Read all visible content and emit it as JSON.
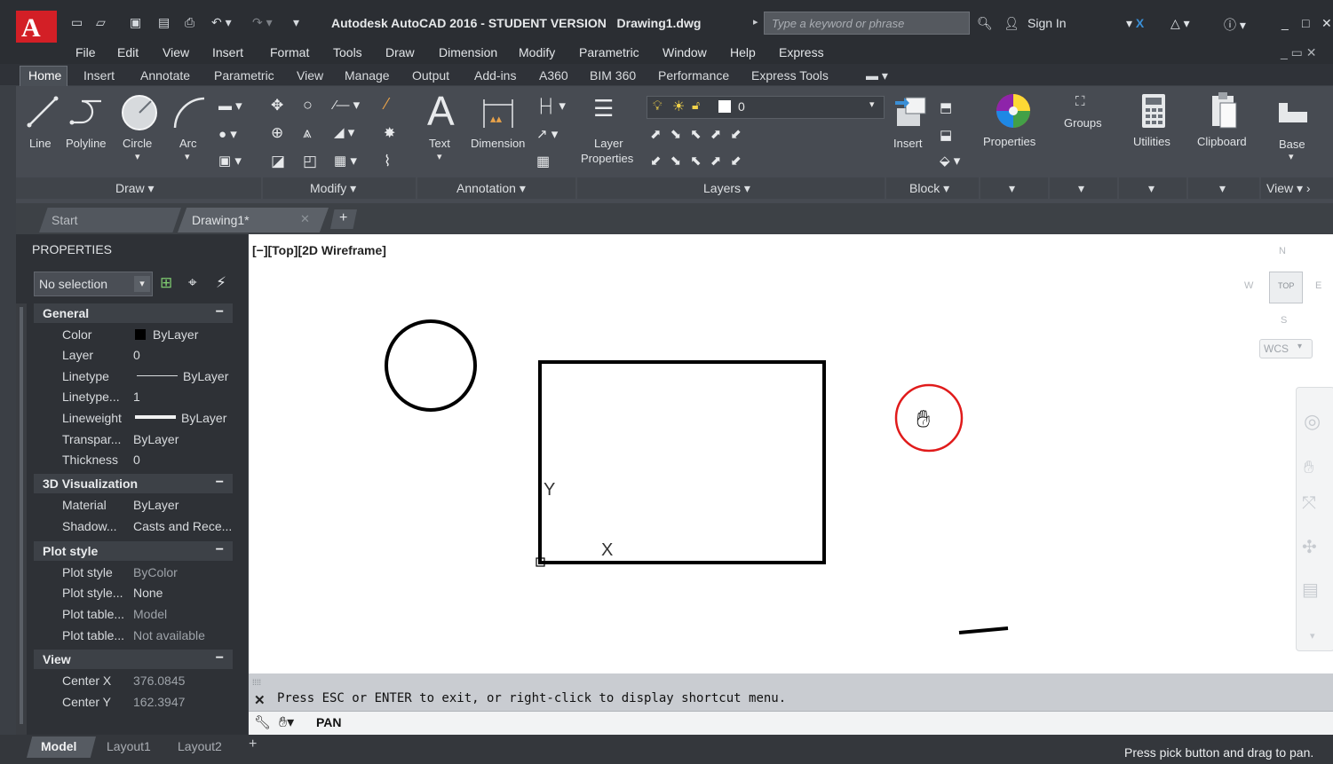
{
  "titlebar": {
    "app_title": "Autodesk AutoCAD 2016 - STUDENT VERSION",
    "file_name": "Drawing1.dwg",
    "search_placeholder": "Type a keyword or phrase",
    "sign_in": "Sign In"
  },
  "menubar": [
    "File",
    "Edit",
    "View",
    "Insert",
    "Format",
    "Tools",
    "Draw",
    "Dimension",
    "Modify",
    "Parametric",
    "Window",
    "Help",
    "Express"
  ],
  "ribbon_tabs": [
    "Home",
    "Insert",
    "Annotate",
    "Parametric",
    "View",
    "Manage",
    "Output",
    "Add-ins",
    "A360",
    "BIM 360",
    "Performance",
    "Express Tools"
  ],
  "ribbon": {
    "draw": {
      "line": "Line",
      "polyline": "Polyline",
      "circle": "Circle",
      "arc": "Arc",
      "panel": "Draw"
    },
    "modify": {
      "panel": "Modify"
    },
    "annotation": {
      "text": "Text",
      "dimension": "Dimension",
      "panel": "Annotation"
    },
    "layers": {
      "layer_properties_1": "Layer",
      "layer_properties_2": "Properties",
      "current_layer": "0",
      "panel": "Layers"
    },
    "block": {
      "insert": "Insert",
      "panel": "Block"
    },
    "properties": "Properties",
    "groups": "Groups",
    "utilities": "Utilities",
    "clipboard": "Clipboard",
    "base": "Base",
    "view_panel": "View"
  },
  "file_tabs": {
    "start": "Start",
    "drawing": "Drawing1*"
  },
  "properties": {
    "title": "PROPERTIES",
    "selection": "No selection",
    "sections": {
      "general": {
        "title": "General",
        "rows": [
          {
            "k": "Color",
            "v": "ByLayer"
          },
          {
            "k": "Layer",
            "v": "0"
          },
          {
            "k": "Linetype",
            "v": "ByLayer"
          },
          {
            "k": "Linetype...",
            "v": "1"
          },
          {
            "k": "Lineweight",
            "v": "ByLayer"
          },
          {
            "k": "Transpar...",
            "v": "ByLayer"
          },
          {
            "k": "Thickness",
            "v": "0"
          }
        ]
      },
      "viz": {
        "title": "3D Visualization",
        "rows": [
          {
            "k": "Material",
            "v": "ByLayer"
          },
          {
            "k": "Shadow...",
            "v": "Casts and Rece..."
          }
        ]
      },
      "plot": {
        "title": "Plot style",
        "rows": [
          {
            "k": "Plot style",
            "v": "ByColor"
          },
          {
            "k": "Plot style...",
            "v": "None"
          },
          {
            "k": "Plot table...",
            "v": "Model"
          },
          {
            "k": "Plot table...",
            "v": "Not available"
          }
        ]
      },
      "view": {
        "title": "View",
        "rows": [
          {
            "k": "Center X",
            "v": "376.0845"
          },
          {
            "k": "Center Y",
            "v": "162.3947"
          }
        ]
      }
    }
  },
  "viewport": {
    "label": "[−][Top][2D Wireframe]",
    "ucs_x": "X",
    "ucs_y": "Y",
    "viewcube": {
      "top": "TOP",
      "w": "W",
      "e": "E",
      "wcs": "WCS"
    }
  },
  "command": {
    "message": "Press ESC or ENTER to exit, or right-click to display shortcut menu.",
    "current": "PAN"
  },
  "layout_tabs": [
    "Model",
    "Layout1",
    "Layout2"
  ],
  "status": {
    "hint": "Press pick button and drag to pan."
  },
  "colors": {
    "accent_red": "#d31f26",
    "highlight_circle": "#e01b1b"
  }
}
